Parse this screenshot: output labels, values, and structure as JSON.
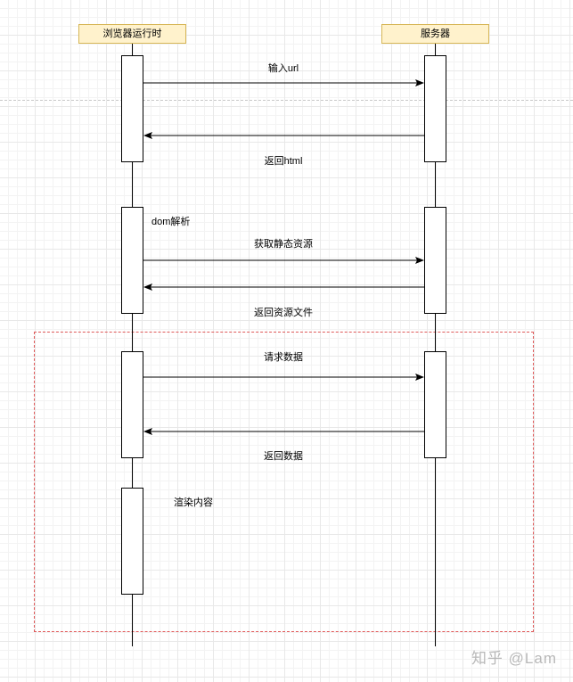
{
  "participants": {
    "browser": "浏览器运行时",
    "server": "服务器"
  },
  "messages": {
    "input_url": "输入url",
    "return_html": "返回html",
    "get_static": "获取静态资源",
    "return_files": "返回资源文件",
    "request_data": "请求数据",
    "return_data": "返回数据"
  },
  "notes": {
    "dom_parse": "dom解析",
    "render_content": "渲染内容"
  },
  "watermark": "知乎 @Lam",
  "colors": {
    "participant_fill": "#fff2cc",
    "participant_border": "#d6b656",
    "frame_border": "#e05a5a"
  }
}
